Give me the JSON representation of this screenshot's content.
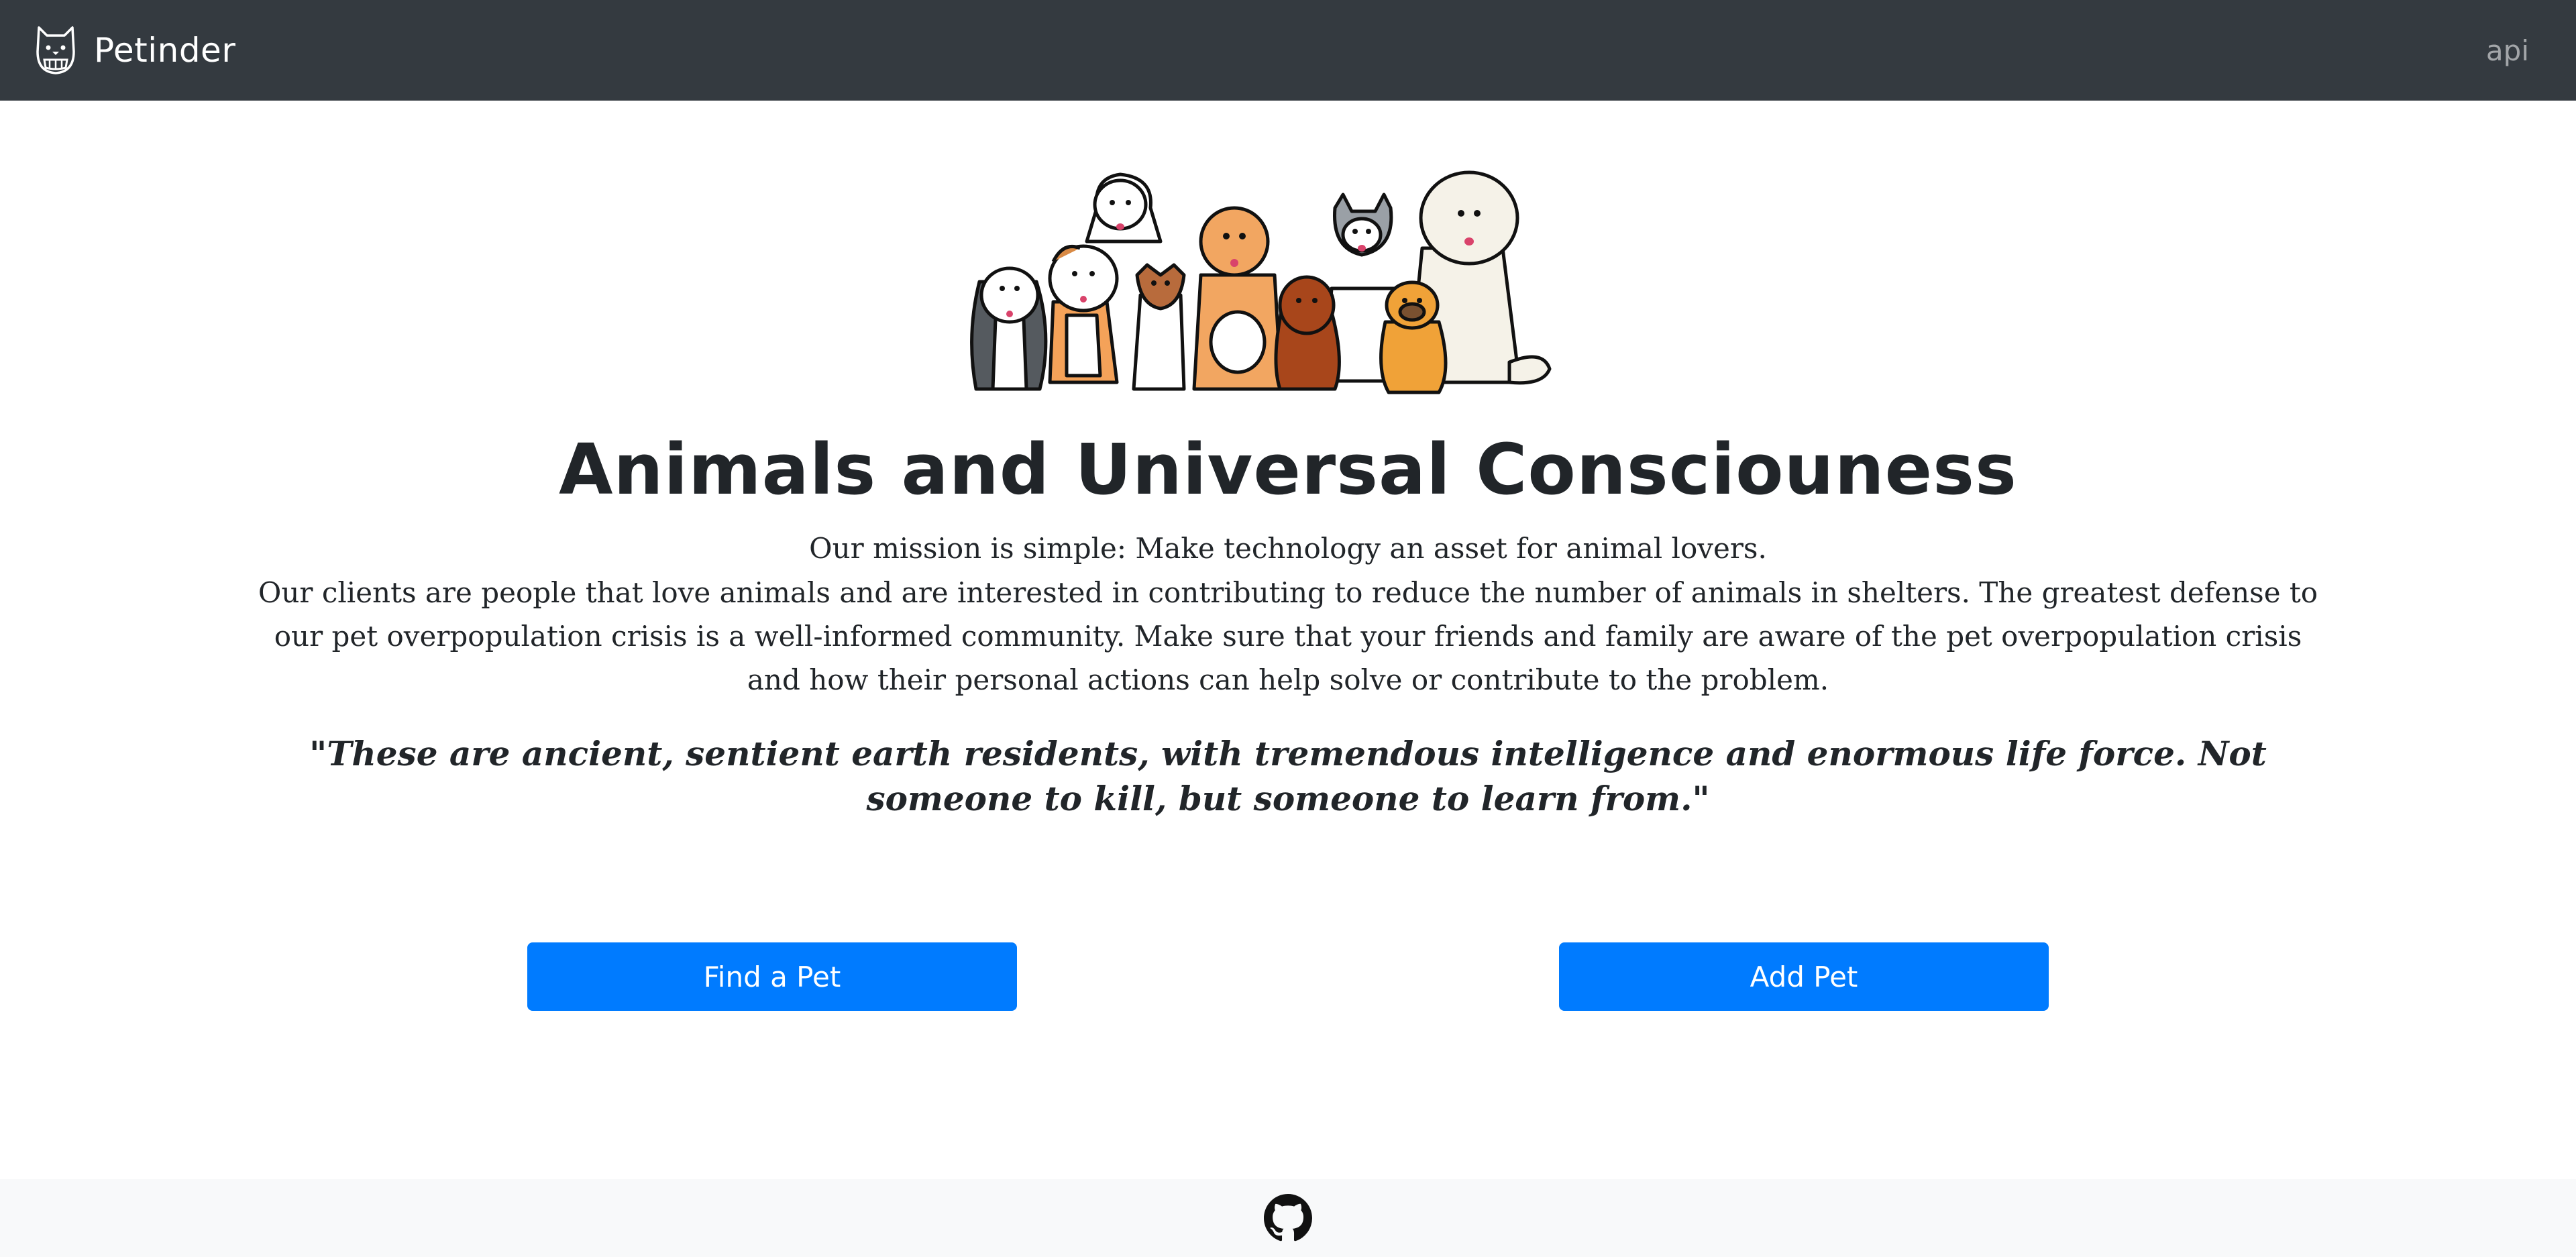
{
  "navbar": {
    "brand_name": "Petinder",
    "logo_icon": "pet-logo-icon",
    "links": {
      "api": "api"
    },
    "background": "#343a40"
  },
  "hero": {
    "image_icon": "dogs-group-illustration",
    "title": "Animals and Universal Consciouness",
    "mission": "Our mission is simple: Make technology an asset for animal lovers.",
    "clients": "Our clients are people that love animals and are interested in contributing to reduce the number of animals in shelters. The greatest defense to our pet overpopulation crisis is a well-informed community. Make sure that your friends and family are aware of the pet overpopulation crisis and how their personal actions can help solve or contribute to the problem.",
    "quote": "\"These are ancient, sentient earth residents, with tremendous intelligence and enormous life force. Not someone to kill, but someone to learn from.\""
  },
  "actions": {
    "find_pet": "Find a Pet",
    "add_pet": "Add Pet",
    "button_color": "#007bff"
  },
  "footer": {
    "github_icon": "github-icon",
    "background": "#f8f9fa"
  }
}
